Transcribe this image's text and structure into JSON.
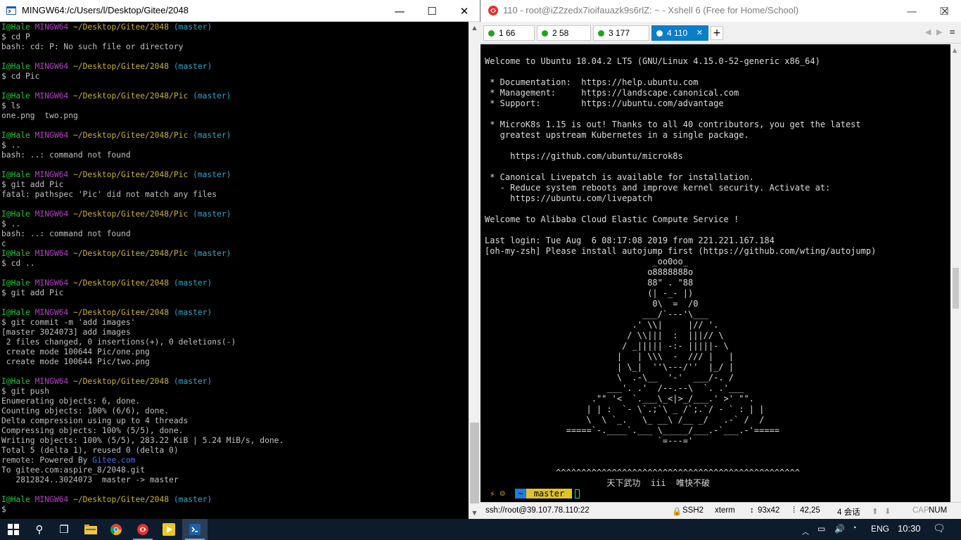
{
  "mingw": {
    "title": "MINGW64:/c/Users/l/Desktop/Gitee/2048",
    "controls": {
      "minimize": "—",
      "maximize": "☐",
      "close": "✕"
    },
    "lines": [
      [
        {
          "t": "I@Hale ",
          "c": "g"
        },
        {
          "t": "MINGW64 ",
          "c": "m"
        },
        {
          "t": "~/Desktop/Gitee/2048 ",
          "c": "y"
        },
        {
          "t": "(master)",
          "c": "c"
        }
      ],
      [
        {
          "t": "$ cd P",
          "c": ""
        }
      ],
      [
        {
          "t": "bash: cd: P: No such file or directory",
          "c": ""
        }
      ],
      [
        {
          "t": "",
          "c": ""
        }
      ],
      [
        {
          "t": "I@Hale ",
          "c": "g"
        },
        {
          "t": "MINGW64 ",
          "c": "m"
        },
        {
          "t": "~/Desktop/Gitee/2048 ",
          "c": "y"
        },
        {
          "t": "(master)",
          "c": "c"
        }
      ],
      [
        {
          "t": "$ cd Pic",
          "c": ""
        }
      ],
      [
        {
          "t": "",
          "c": ""
        }
      ],
      [
        {
          "t": "I@Hale ",
          "c": "g"
        },
        {
          "t": "MINGW64 ",
          "c": "m"
        },
        {
          "t": "~/Desktop/Gitee/2048/Pic ",
          "c": "y"
        },
        {
          "t": "(master)",
          "c": "c"
        }
      ],
      [
        {
          "t": "$ ls",
          "c": ""
        }
      ],
      [
        {
          "t": "one.png  two.png",
          "c": ""
        }
      ],
      [
        {
          "t": "",
          "c": ""
        }
      ],
      [
        {
          "t": "I@Hale ",
          "c": "g"
        },
        {
          "t": "MINGW64 ",
          "c": "m"
        },
        {
          "t": "~/Desktop/Gitee/2048/Pic ",
          "c": "y"
        },
        {
          "t": "(master)",
          "c": "c"
        }
      ],
      [
        {
          "t": "$ ..",
          "c": ""
        }
      ],
      [
        {
          "t": "bash: ..: command not found",
          "c": ""
        }
      ],
      [
        {
          "t": "",
          "c": ""
        }
      ],
      [
        {
          "t": "I@Hale ",
          "c": "g"
        },
        {
          "t": "MINGW64 ",
          "c": "m"
        },
        {
          "t": "~/Desktop/Gitee/2048/Pic ",
          "c": "y"
        },
        {
          "t": "(master)",
          "c": "c"
        }
      ],
      [
        {
          "t": "$ git add Pic",
          "c": ""
        }
      ],
      [
        {
          "t": "fatal: pathspec 'Pic' did not match any files",
          "c": ""
        }
      ],
      [
        {
          "t": "",
          "c": ""
        }
      ],
      [
        {
          "t": "I@Hale ",
          "c": "g"
        },
        {
          "t": "MINGW64 ",
          "c": "m"
        },
        {
          "t": "~/Desktop/Gitee/2048/Pic ",
          "c": "y"
        },
        {
          "t": "(master)",
          "c": "c"
        }
      ],
      [
        {
          "t": "$ ..",
          "c": ""
        }
      ],
      [
        {
          "t": "bash: ..: command not found",
          "c": ""
        }
      ],
      [
        {
          "t": "c",
          "c": ""
        }
      ],
      [
        {
          "t": "I@Hale ",
          "c": "g"
        },
        {
          "t": "MINGW64 ",
          "c": "m"
        },
        {
          "t": "~/Desktop/Gitee/2048/Pic ",
          "c": "y"
        },
        {
          "t": "(master)",
          "c": "c"
        }
      ],
      [
        {
          "t": "$ cd ..",
          "c": ""
        }
      ],
      [
        {
          "t": "",
          "c": ""
        }
      ],
      [
        {
          "t": "I@Hale ",
          "c": "g"
        },
        {
          "t": "MINGW64 ",
          "c": "m"
        },
        {
          "t": "~/Desktop/Gitee/2048 ",
          "c": "y"
        },
        {
          "t": "(master)",
          "c": "c"
        }
      ],
      [
        {
          "t": "$ git add Pic",
          "c": ""
        }
      ],
      [
        {
          "t": "",
          "c": ""
        }
      ],
      [
        {
          "t": "I@Hale ",
          "c": "g"
        },
        {
          "t": "MINGW64 ",
          "c": "m"
        },
        {
          "t": "~/Desktop/Gitee/2048 ",
          "c": "y"
        },
        {
          "t": "(master)",
          "c": "c"
        }
      ],
      [
        {
          "t": "$ git commit -m 'add images'",
          "c": ""
        }
      ],
      [
        {
          "t": "[master 3024073] add images",
          "c": ""
        }
      ],
      [
        {
          "t": " 2 files changed, 0 insertions(+), 0 deletions(-)",
          "c": ""
        }
      ],
      [
        {
          "t": " create mode 100644 Pic/one.png",
          "c": ""
        }
      ],
      [
        {
          "t": " create mode 100644 Pic/two.png",
          "c": ""
        }
      ],
      [
        {
          "t": "",
          "c": ""
        }
      ],
      [
        {
          "t": "I@Hale ",
          "c": "g"
        },
        {
          "t": "MINGW64 ",
          "c": "m"
        },
        {
          "t": "~/Desktop/Gitee/2048 ",
          "c": "y"
        },
        {
          "t": "(master)",
          "c": "c"
        }
      ],
      [
        {
          "t": "$ git push",
          "c": ""
        }
      ],
      [
        {
          "t": "Enumerating objects: 6, done.",
          "c": ""
        }
      ],
      [
        {
          "t": "Counting objects: 100% (6/6), done.",
          "c": ""
        }
      ],
      [
        {
          "t": "Delta compression using up to 4 threads",
          "c": ""
        }
      ],
      [
        {
          "t": "Compressing objects: 100% (5/5), done.",
          "c": ""
        }
      ],
      [
        {
          "t": "Writing objects: 100% (5/5), 283.22 KiB | 5.24 MiB/s, done.",
          "c": ""
        }
      ],
      [
        {
          "t": "Total 5 (delta 1), reused 0 (delta 0)",
          "c": ""
        }
      ],
      [
        {
          "t": "remote: Powered By ",
          "c": ""
        },
        {
          "t": "Gitee.com",
          "c": "l"
        }
      ],
      [
        {
          "t": "To gitee.com:aspire_8/2048.git",
          "c": ""
        }
      ],
      [
        {
          "t": "   2812824..3024073  master -> master",
          "c": ""
        }
      ],
      [
        {
          "t": "",
          "c": ""
        }
      ],
      [
        {
          "t": "I@Hale ",
          "c": "g"
        },
        {
          "t": "MINGW64 ",
          "c": "m"
        },
        {
          "t": "~/Desktop/Gitee/2048 ",
          "c": "y"
        },
        {
          "t": "(master)",
          "c": "c"
        }
      ],
      [
        {
          "t": "$",
          "c": ""
        }
      ]
    ]
  },
  "xshell": {
    "title": "110 - root@iZ2zedx7ioifauazk9s6rlZ: ~ - Xshell 6 (Free for Home/School)",
    "controls": {
      "minimize": "—",
      "maximize": "☐",
      "close": "✕"
    },
    "tabs": [
      {
        "label": "1 66",
        "active": false
      },
      {
        "label": "2 58",
        "active": false
      },
      {
        "label": "3 177",
        "active": false
      },
      {
        "label": "4 110",
        "active": true
      }
    ],
    "tab_close": "✕",
    "tab_add": "+",
    "tab_prev": "◀",
    "tab_next": "▶",
    "lines": [
      {
        "t": "Welcome to Ubuntu 18.04.2 LTS (GNU/Linux 4.15.0-52-generic x86_64)",
        "c": ""
      },
      {
        "t": "",
        "c": ""
      },
      {
        "t": " * Documentation:  https://help.ubuntu.com",
        "c": ""
      },
      {
        "t": " * Management:     https://landscape.canonical.com",
        "c": ""
      },
      {
        "t": " * Support:        https://ubuntu.com/advantage",
        "c": ""
      },
      {
        "t": "",
        "c": ""
      },
      {
        "t": " * MicroK8s 1.15 is out! Thanks to all 40 contributors, you get the latest",
        "c": ""
      },
      {
        "t": "   greatest upstream Kubernetes in a single package.",
        "c": ""
      },
      {
        "t": "",
        "c": ""
      },
      {
        "t": "     https://github.com/ubuntu/microk8s",
        "c": ""
      },
      {
        "t": "",
        "c": ""
      },
      {
        "t": " * Canonical Livepatch is available for installation.",
        "c": ""
      },
      {
        "t": "   - Reduce system reboots and improve kernel security. Activate at:",
        "c": ""
      },
      {
        "t": "     https://ubuntu.com/livepatch",
        "c": ""
      },
      {
        "t": "",
        "c": ""
      },
      {
        "t": "Welcome to Alibaba Cloud Elastic Compute Service !",
        "c": ""
      },
      {
        "t": "",
        "c": ""
      },
      {
        "t": "Last login: Tue Aug  6 08:17:08 2019 from 221.221.167.184",
        "c": ""
      },
      {
        "t": "[oh-my-zsh] Please install autojump first (https://github.com/wting/autojump)",
        "c": ""
      },
      {
        "t": "                                 _oo0oo_",
        "c": "a"
      },
      {
        "t": "                                o8888888o",
        "c": "a"
      },
      {
        "t": "                                88\" . \"88",
        "c": "a"
      },
      {
        "t": "                                (| -_- |)",
        "c": "a"
      },
      {
        "t": "                                 0\\  =  /0",
        "c": "a"
      },
      {
        "t": "                               ___/`---'\\___",
        "c": "a"
      },
      {
        "t": "                             .' \\\\|     |// '.",
        "c": "a"
      },
      {
        "t": "                            / \\\\|||  :  |||// \\",
        "c": "a"
      },
      {
        "t": "                           / _||||| -:- |||||- \\",
        "c": "a"
      },
      {
        "t": "                          |   | \\\\\\  -  /// |   |",
        "c": "a"
      },
      {
        "t": "                          | \\_|  ''\\---/''  |_/ |",
        "c": "a"
      },
      {
        "t": "                          \\  .-\\__  '-'  ___/-. /",
        "c": "a"
      },
      {
        "t": "                        ___'. .'  /--.--\\  `. .'___",
        "c": "a"
      },
      {
        "t": "                     .\"\" '<  `.___\\_<|>_/___.' >' \"\".",
        "c": "a"
      },
      {
        "t": "                    | | :  `- \\`.;`\\ _ /`;.`/ - ` : | |",
        "c": "a"
      },
      {
        "t": "                    \\  \\ `_.   \\_ __\\ /__ _/   .-` /  /",
        "c": "a"
      },
      {
        "t": "                =====`-.____`.___ \\_____/___.-`___.-'=====",
        "c": "a"
      },
      {
        "t": "                                  `=---='",
        "c": "a"
      },
      {
        "t": "",
        "c": ""
      },
      {
        "t": "",
        "c": ""
      },
      {
        "t": "              ^^^^^^^^^^^^^^^^^^^^^^^^^^^^^^^^^^^^^^^^^^^^^^^^",
        "c": "a"
      },
      {
        "t": "                        天下武功  iii  唯快不破",
        "c": "a"
      }
    ],
    "prompt": {
      "lead": " ⚡ ☺  ",
      "dir": "~",
      "branch": " master "
    },
    "status": {
      "connection": "ssh://root@39.107.78.110:22",
      "protocol": "SSH2",
      "term": "xterm",
      "size": "93x42",
      "cursor": "42,25",
      "sessions": "4 会话",
      "caps": "CAP",
      "num": "NUM"
    }
  },
  "taskbar": {
    "start_icon": "windows-icon",
    "search_glyph": "⚲",
    "taskview_glyph": "❐",
    "tray": {
      "lang": "ENG",
      "time": "10:30"
    }
  }
}
